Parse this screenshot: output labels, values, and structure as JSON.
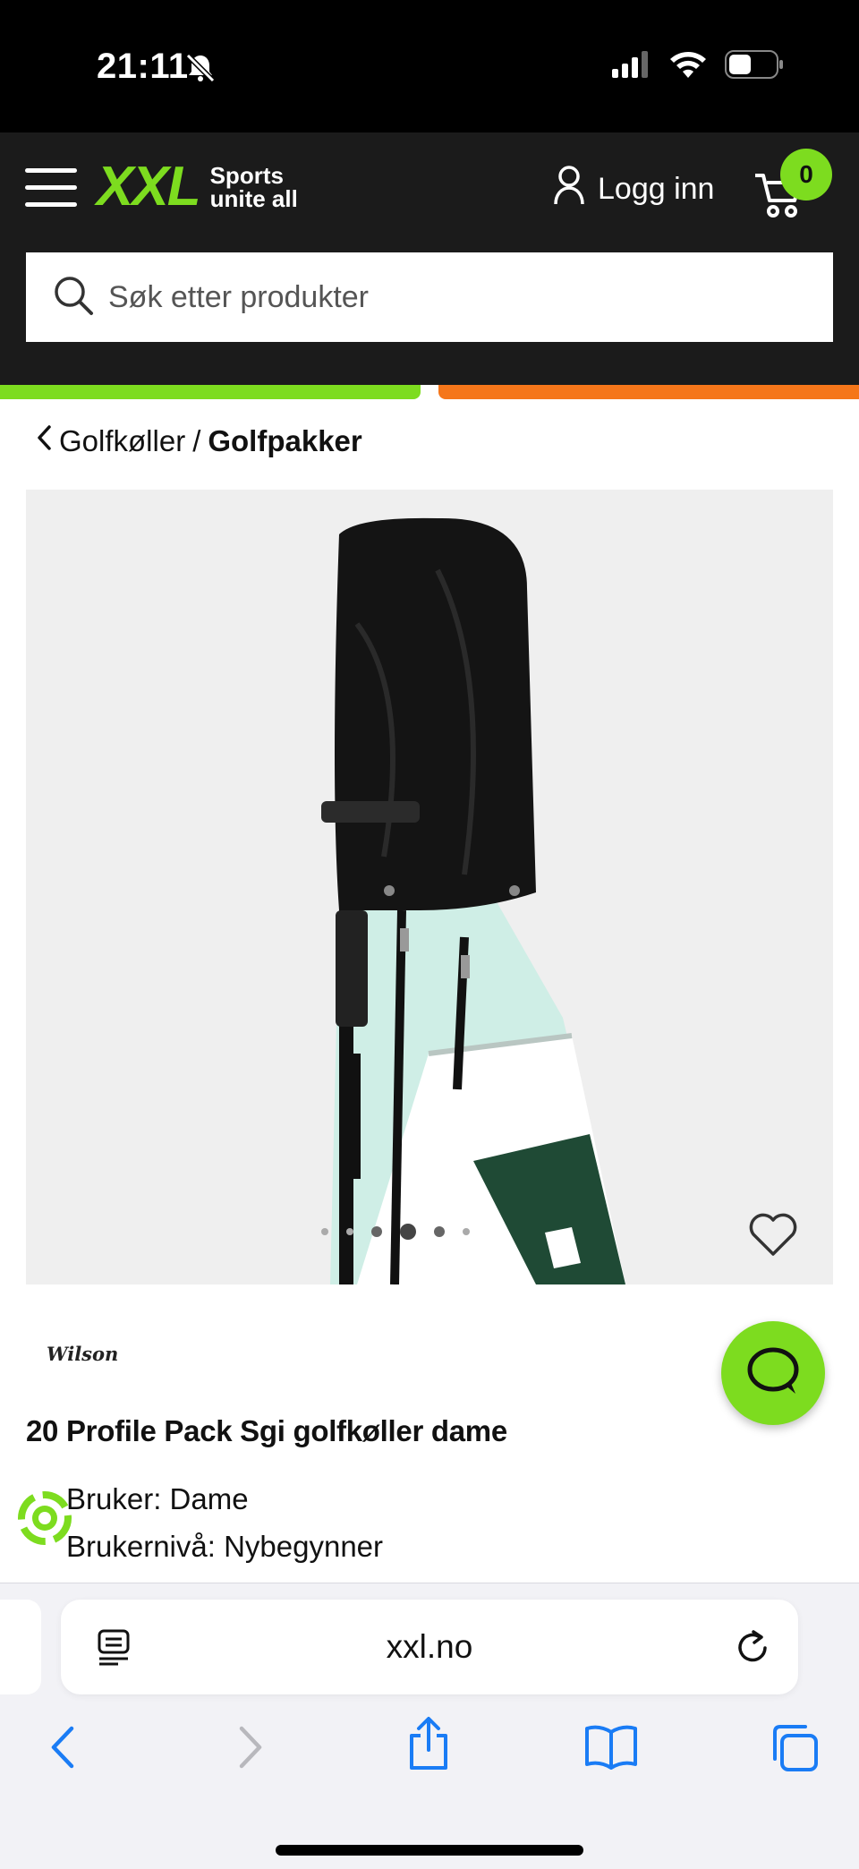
{
  "status_bar": {
    "time": "21:11"
  },
  "header": {
    "logo_text": "XXL",
    "logo_tagline_1": "Sports",
    "logo_tagline_2": "unite all",
    "login_label": "Logg inn",
    "cart_count": "0",
    "search_placeholder": "Søk etter produkter",
    "accent_green": "#7ddc1f",
    "accent_orange": "#f5761a"
  },
  "breadcrumb": {
    "parent": "Golfkøller",
    "separator": "/",
    "current": "Golfpakker"
  },
  "product": {
    "brand": "Wilson",
    "title": "20 Profile Pack Sgi golfkøller dame",
    "specs": [
      "Bruker: Dame",
      "Brukernivå: Nybegynner"
    ],
    "gallery_dots": 6,
    "gallery_active_index": 3
  },
  "browser": {
    "url": "xxl.no"
  }
}
